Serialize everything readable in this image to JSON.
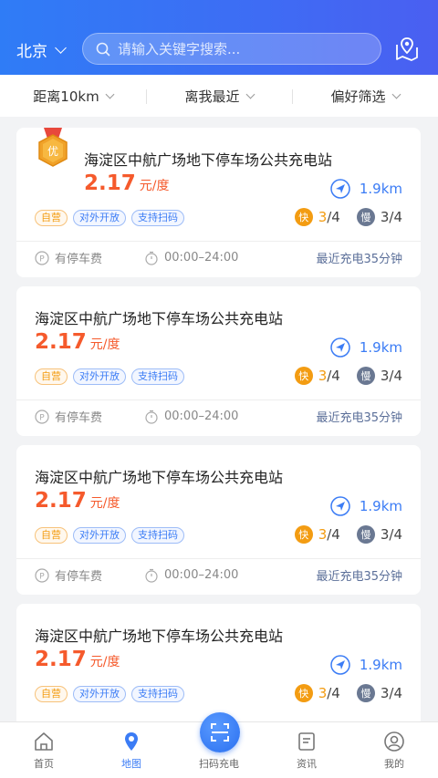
{
  "header": {
    "city": "北京",
    "search_placeholder": "请输入关键字搜索..."
  },
  "filters": [
    {
      "label": "距离10km"
    },
    {
      "label": "离我最近"
    },
    {
      "label": "偏好筛选"
    }
  ],
  "stations": [
    {
      "name": "海淀区中航广场地下停车场公共充电站",
      "price": "2.17",
      "unit": "元/度",
      "distance": "1.9km",
      "tags": [
        "自营",
        "对外开放",
        "支持扫码"
      ],
      "fast_label": "快",
      "fast_available": "3",
      "fast_total": "/4",
      "slow_label": "慢",
      "slow_count": "3/4",
      "parking": "有停车费",
      "hours": "00:00–24:00",
      "recent": "最近充电35分钟",
      "medal": "优"
    },
    {
      "name": "海淀区中航广场地下停车场公共充电站",
      "price": "2.17",
      "unit": "元/度",
      "distance": "1.9km",
      "tags": [
        "自营",
        "对外开放",
        "支持扫码"
      ],
      "fast_label": "快",
      "fast_available": "3",
      "fast_total": "/4",
      "slow_label": "慢",
      "slow_count": "3/4",
      "parking": "有停车费",
      "hours": "00:00–24:00",
      "recent": "最近充电35分钟"
    },
    {
      "name": "海淀区中航广场地下停车场公共充电站",
      "price": "2.17",
      "unit": "元/度",
      "distance": "1.9km",
      "tags": [
        "自营",
        "对外开放",
        "支持扫码"
      ],
      "fast_label": "快",
      "fast_available": "3",
      "fast_total": "/4",
      "slow_label": "慢",
      "slow_count": "3/4",
      "parking": "有停车费",
      "hours": "00:00–24:00",
      "recent": "最近充电35分钟"
    },
    {
      "name": "海淀区中航广场地下停车场公共充电站",
      "price": "2.17",
      "unit": "元/度",
      "distance": "1.9km",
      "tags": [
        "自营",
        "对外开放",
        "支持扫码"
      ],
      "fast_label": "快",
      "fast_available": "3",
      "fast_total": "/4",
      "slow_label": "慢",
      "slow_count": "3/4"
    }
  ],
  "tabbar": [
    {
      "label": "首页"
    },
    {
      "label": "地图"
    },
    {
      "label": "扫码充电"
    },
    {
      "label": "资讯"
    },
    {
      "label": "我的"
    }
  ],
  "colors": {
    "accent": "#3b7cf5",
    "price": "#f55a2c",
    "fast": "#f39c12",
    "slow": "#6a7892"
  }
}
